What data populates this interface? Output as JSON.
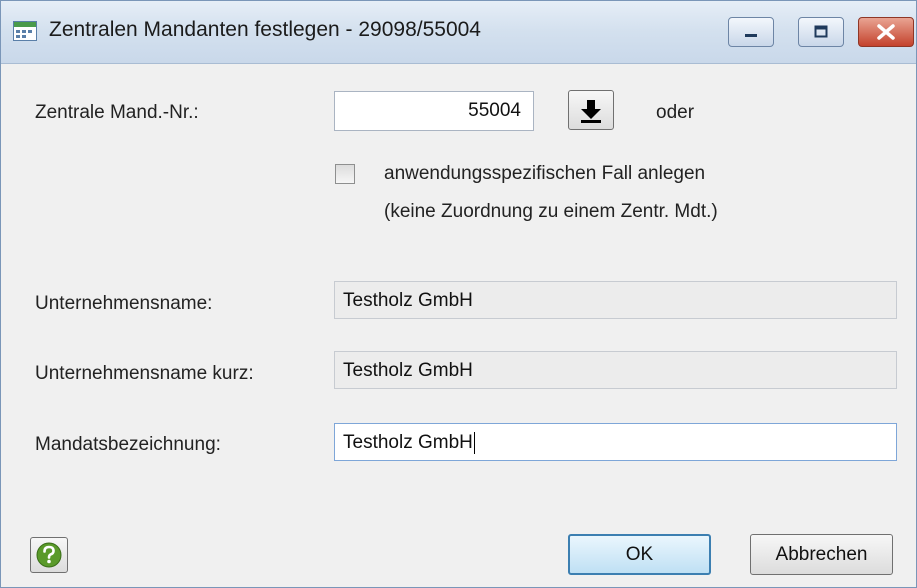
{
  "window": {
    "title": "Zentralen Mandanten festlegen - 29098/55004"
  },
  "form": {
    "zentrale_label": "Zentrale Mand.-Nr.:",
    "zentrale_value": "55004",
    "oder_label": "oder",
    "checkbox_line1": "anwendungsspezifischen Fall anlegen",
    "checkbox_line2": "(keine Zuordnung zu einem Zentr. Mdt.)",
    "checkbox_checked": false,
    "unternehmensname_label": "Unternehmensname:",
    "unternehmensname_value": "Testholz GmbH",
    "unternehmensname_kurz_label": "Unternehmensname kurz:",
    "unternehmensname_kurz_value": "Testholz GmbH",
    "mandatsbezeichnung_label": "Mandatsbezeichnung:",
    "mandatsbezeichnung_value": "Testholz GmbH"
  },
  "buttons": {
    "ok": "OK",
    "cancel": "Abbrechen"
  },
  "icons": {
    "app": "window-app-icon",
    "minimize": "minimize-icon",
    "maximize": "maximize-icon",
    "close": "close-icon",
    "download": "down-arrow-icon",
    "help": "help-icon"
  },
  "colors": {
    "close_button": "#c4422c",
    "help_icon": "#5a9a2a",
    "ok_border": "#3c7fb1"
  }
}
